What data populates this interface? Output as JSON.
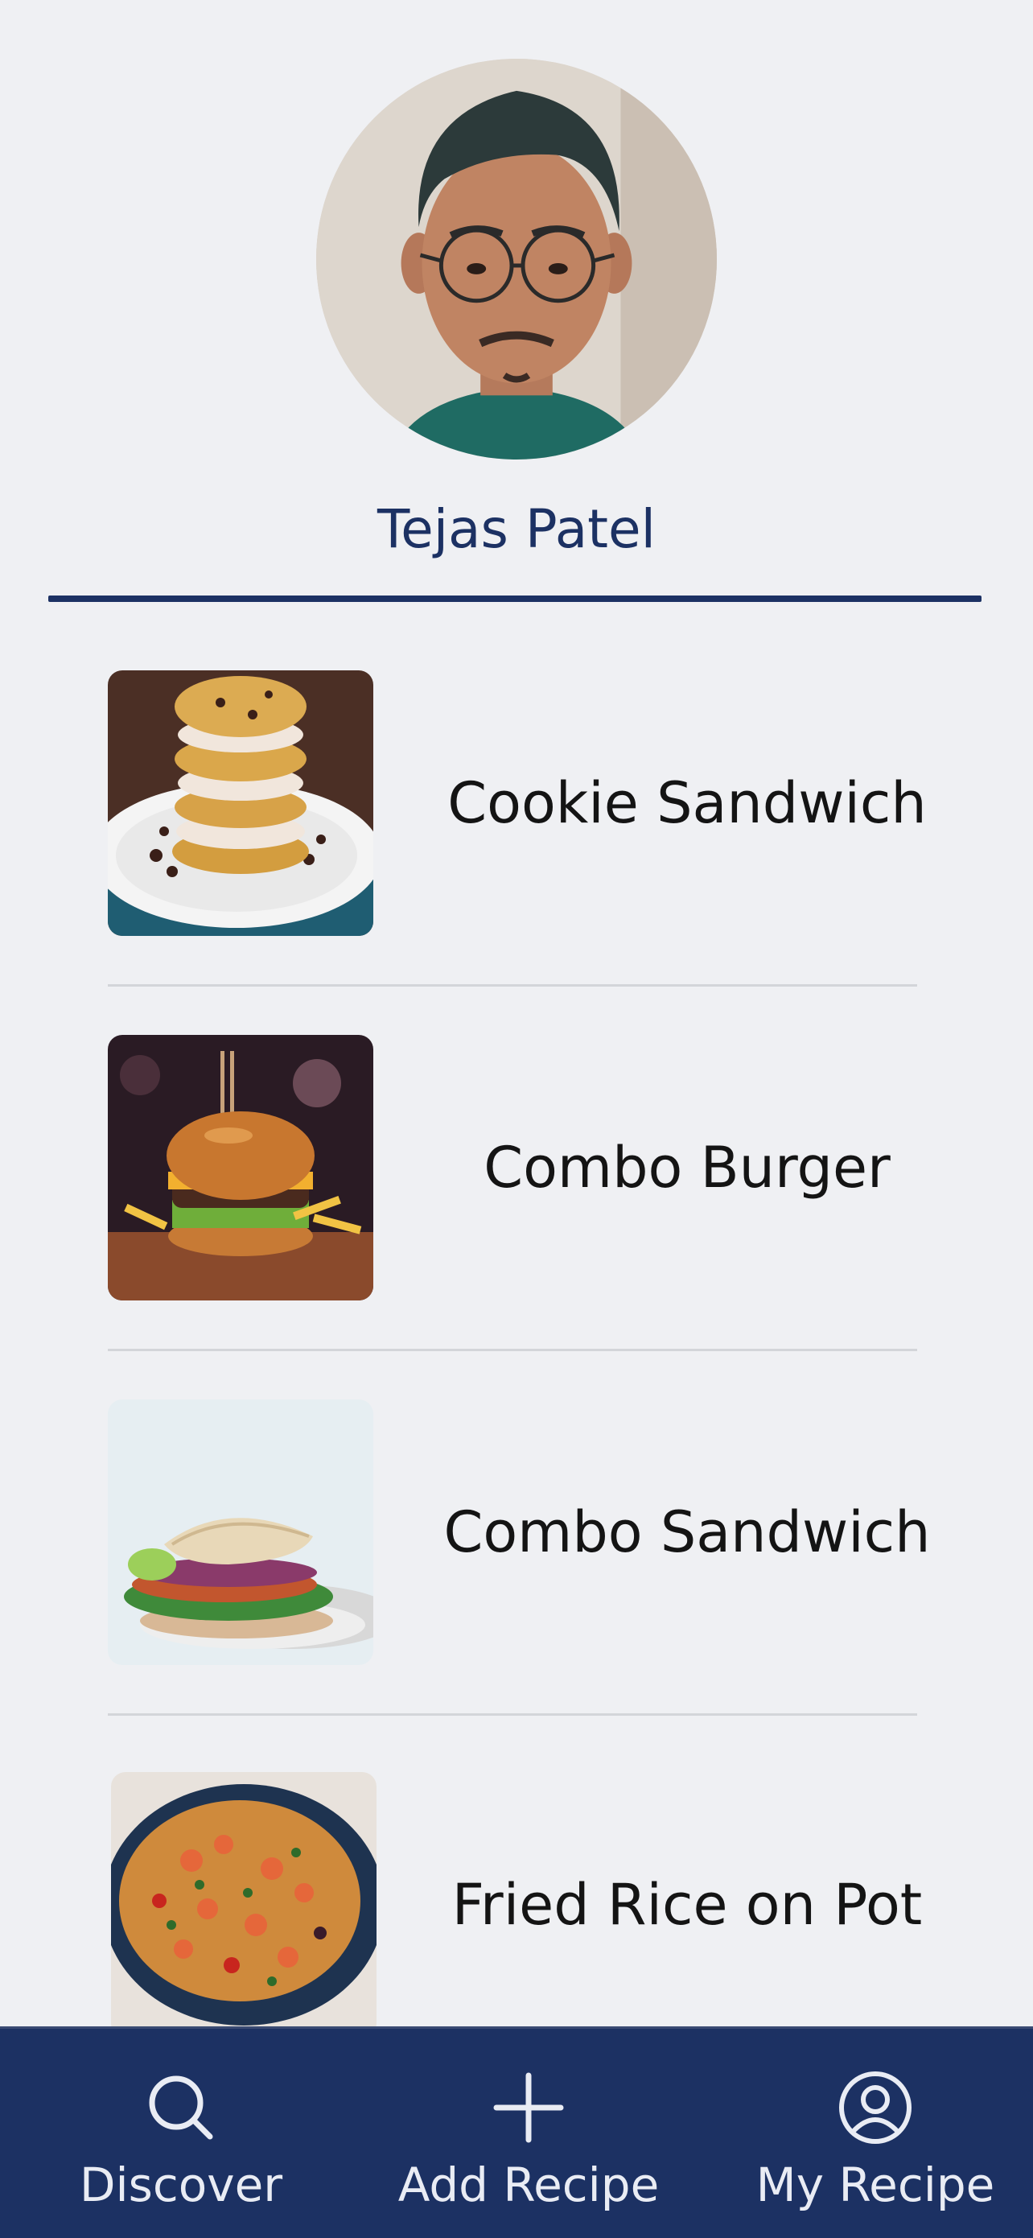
{
  "profile": {
    "name": "Tejas Patel"
  },
  "recipes": [
    {
      "title": "Cookie Sandwich"
    },
    {
      "title": "Combo Burger"
    },
    {
      "title": "Combo Sandwich"
    },
    {
      "title": "Fried Rice on Pot"
    }
  ],
  "tabs": [
    {
      "label": "Discover",
      "icon": "search-icon"
    },
    {
      "label": "Add Recipe",
      "icon": "plus-icon"
    },
    {
      "label": "My Recipe",
      "icon": "user-circle-icon"
    }
  ],
  "colors": {
    "background": "#eff0f3",
    "primary": "#1c3163",
    "tab_text": "#e9ecf4",
    "separator": "#d3d5d9"
  }
}
